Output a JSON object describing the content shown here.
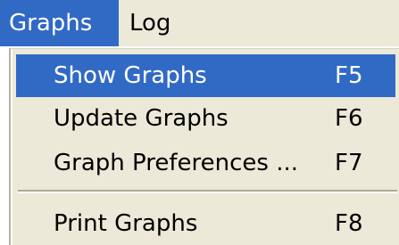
{
  "menubar": {
    "items": [
      {
        "label": "Graphs",
        "active": true
      },
      {
        "label": "Log",
        "active": false
      }
    ]
  },
  "dropdown": {
    "items": [
      {
        "label": "Show Graphs",
        "shortcut": "F5",
        "highlighted": true
      },
      {
        "label": "Update Graphs",
        "shortcut": "F6",
        "highlighted": false
      },
      {
        "label": "Graph Preferences ...",
        "shortcut": "F7",
        "highlighted": false
      },
      {
        "label": "Print Graphs",
        "shortcut": "F8",
        "highlighted": false
      }
    ]
  },
  "colors": {
    "menu_background": "#ece9d8",
    "highlight": "#316ac5",
    "highlight_text": "#ffffff",
    "text": "#000000",
    "separator_dark": "#aca899"
  }
}
